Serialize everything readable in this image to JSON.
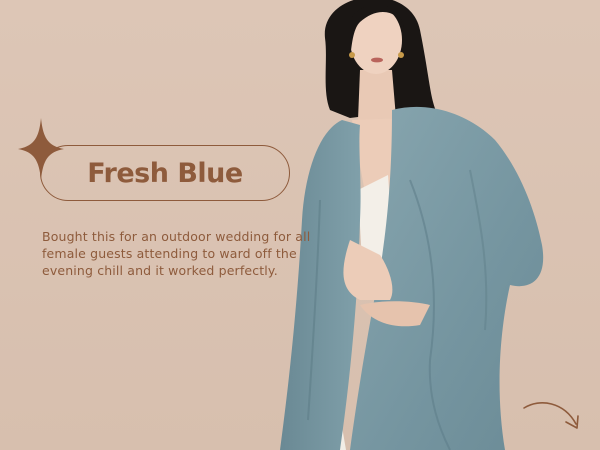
{
  "banner": {
    "title": "Fresh Blue",
    "description": "Bought this for an outdoor wedding for all female guests attending to ward off the evening chill and it worked perfectly.",
    "colors": {
      "background": "#dbc3b3",
      "accent_brown": "#8e5b3c",
      "scarf_blue": "#7b9aa3"
    },
    "icons": {
      "sparkle": "four-point-star-icon",
      "arrow": "curved-arrow-icon"
    }
  }
}
